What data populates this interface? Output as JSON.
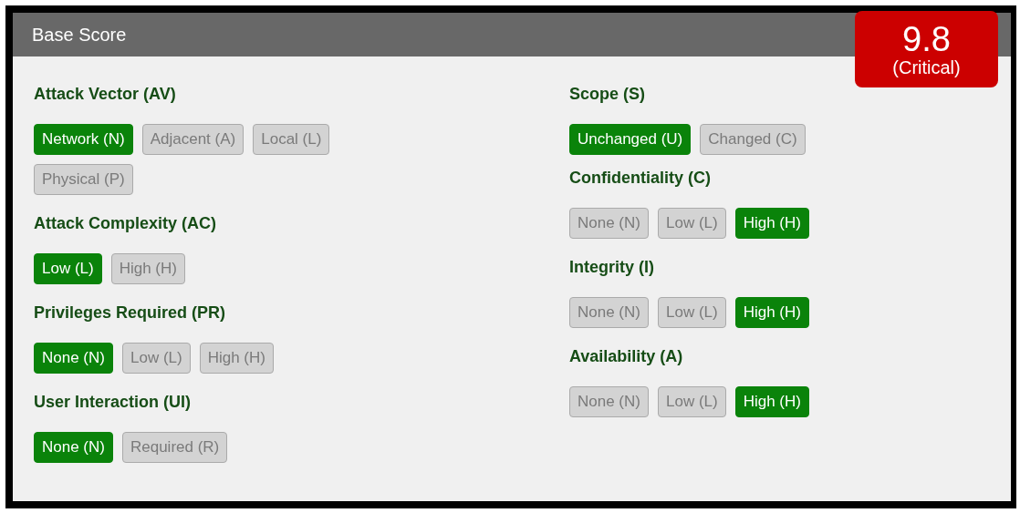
{
  "panel": {
    "title": "Base Score"
  },
  "score": {
    "value": "9.8",
    "severity": "(Critical)"
  },
  "columns": [
    [
      {
        "name": "Attack Vector (AV)",
        "options": [
          {
            "label": "Network (N)",
            "selected": true
          },
          {
            "label": "Adjacent (A)",
            "selected": false
          },
          {
            "label": "Local (L)",
            "selected": false
          },
          {
            "label": "Physical (P)",
            "selected": false
          }
        ]
      },
      {
        "name": "Attack Complexity (AC)",
        "options": [
          {
            "label": "Low (L)",
            "selected": true
          },
          {
            "label": "High (H)",
            "selected": false
          }
        ]
      },
      {
        "name": "Privileges Required (PR)",
        "options": [
          {
            "label": "None (N)",
            "selected": true
          },
          {
            "label": "Low (L)",
            "selected": false
          },
          {
            "label": "High (H)",
            "selected": false
          }
        ]
      },
      {
        "name": "User Interaction (UI)",
        "options": [
          {
            "label": "None (N)",
            "selected": true
          },
          {
            "label": "Required (R)",
            "selected": false
          }
        ]
      }
    ],
    [
      {
        "name": "Scope (S)",
        "options": [
          {
            "label": "Unchanged (U)",
            "selected": true
          },
          {
            "label": "Changed (C)",
            "selected": false
          }
        ]
      },
      {
        "name": "Confidentiality (C)",
        "options": [
          {
            "label": "None (N)",
            "selected": false
          },
          {
            "label": "Low (L)",
            "selected": false
          },
          {
            "label": "High (H)",
            "selected": true
          }
        ]
      },
      {
        "name": "Integrity (I)",
        "options": [
          {
            "label": "None (N)",
            "selected": false
          },
          {
            "label": "Low (L)",
            "selected": false
          },
          {
            "label": "High (H)",
            "selected": true
          }
        ]
      },
      {
        "name": "Availability (A)",
        "options": [
          {
            "label": "None (N)",
            "selected": false
          },
          {
            "label": "Low (L)",
            "selected": false
          },
          {
            "label": "High (H)",
            "selected": true
          }
        ]
      }
    ]
  ]
}
